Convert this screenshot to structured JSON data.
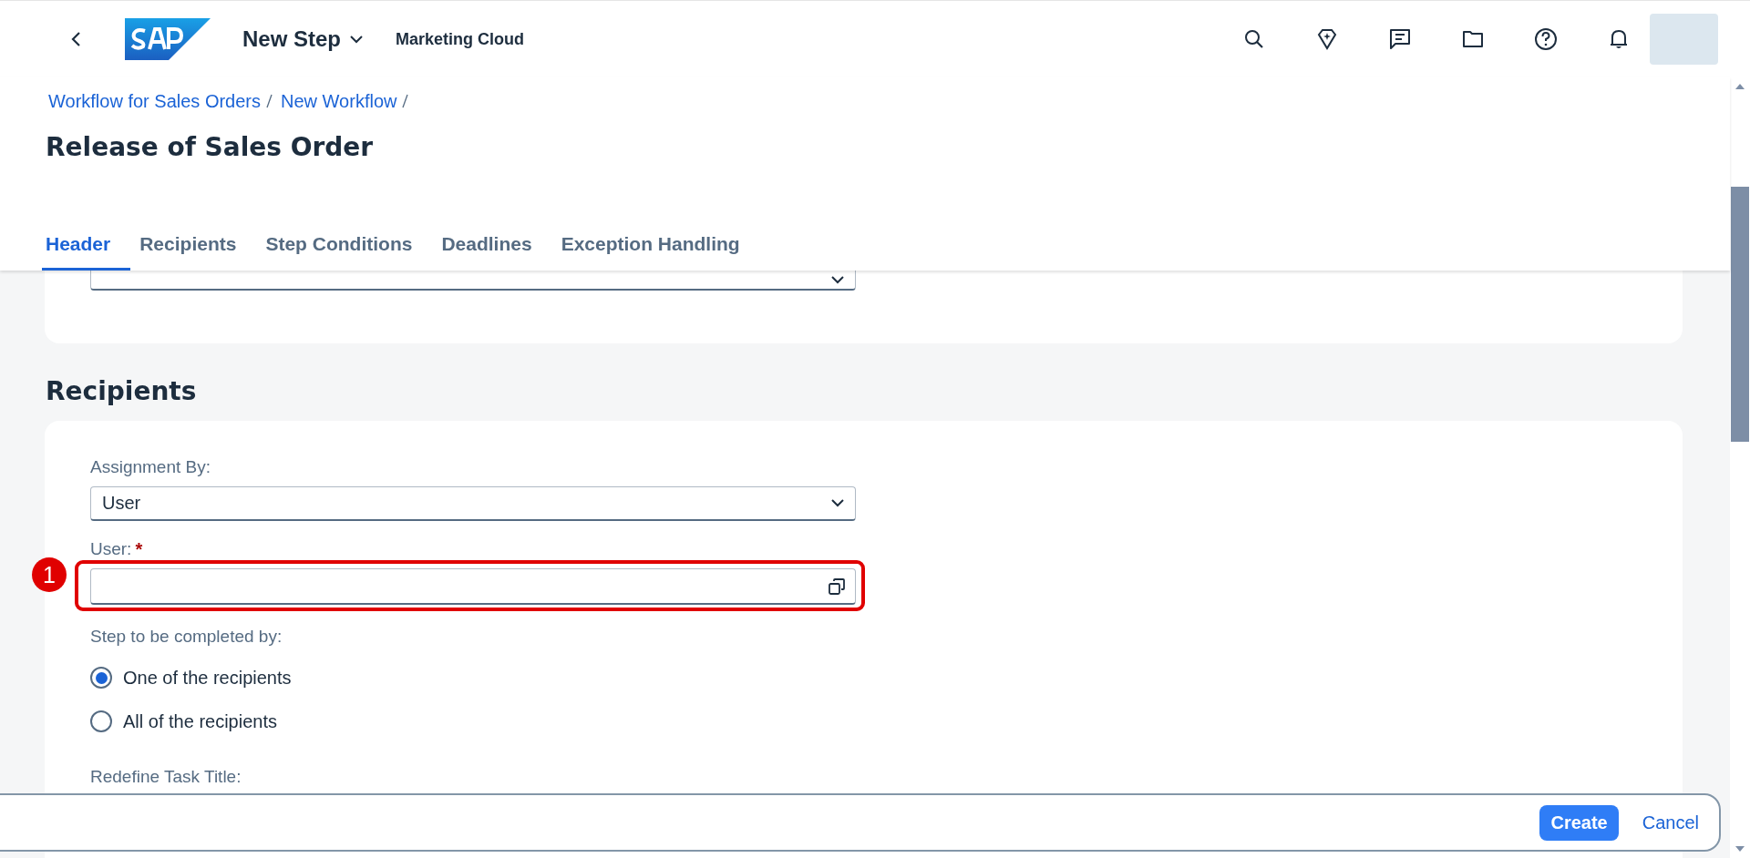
{
  "shell": {
    "title": "New Step",
    "subtitle": "Marketing Cloud"
  },
  "breadcrumbs": [
    "Workflow for Sales Orders",
    "New Workflow"
  ],
  "page_title": "Release of Sales Order",
  "tabs": [
    {
      "label": "Header",
      "selected": true
    },
    {
      "label": "Recipients",
      "selected": false
    },
    {
      "label": "Step Conditions",
      "selected": false
    },
    {
      "label": "Deadlines",
      "selected": false
    },
    {
      "label": "Exception Handling",
      "selected": false
    }
  ],
  "section_title": "Recipients",
  "assignment": {
    "label": "Assignment By:",
    "value": "User"
  },
  "user_field": {
    "label": "User:",
    "required_mark": "*"
  },
  "annotation": "1",
  "completion": {
    "label": "Step to be completed by:",
    "options": [
      {
        "label": "One of the recipients",
        "selected": true
      },
      {
        "label": "All of the recipients",
        "selected": false
      }
    ]
  },
  "task_title_label": "Redefine Task Title:",
  "footer": {
    "primary": "Create",
    "secondary": "Cancel"
  }
}
